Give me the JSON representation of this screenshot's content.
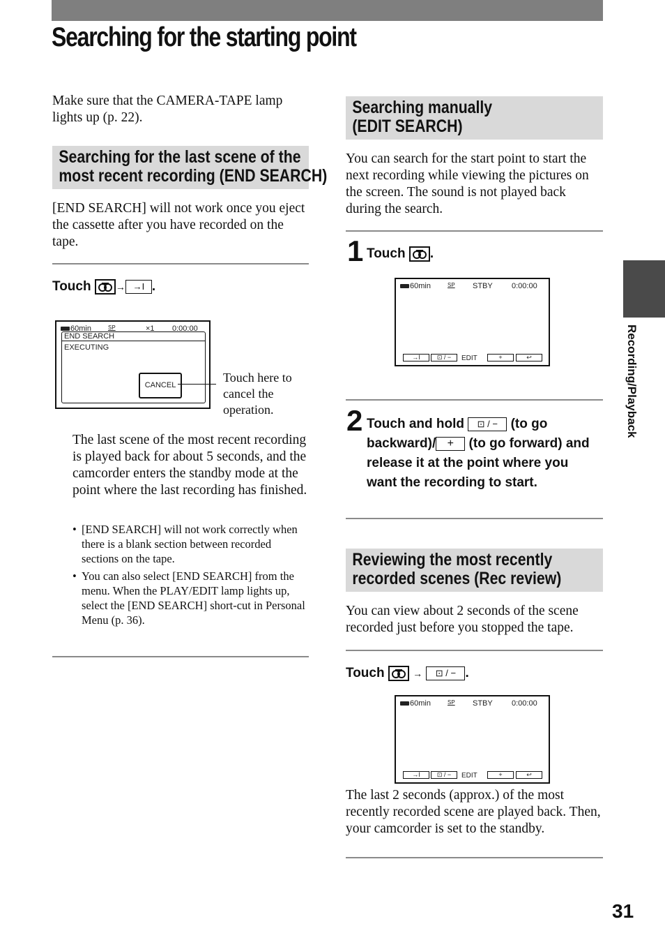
{
  "page": {
    "title": "Searching for the starting point",
    "page_number": "31",
    "side_tab_label": "Recording/Playback"
  },
  "left": {
    "intro": "Make sure that the CAMERA-TAPE lamp lights up (p. 22).",
    "section_heading_line1": "Searching for the last scene of the",
    "section_heading_line2": "most recent recording (END SEARCH)",
    "section_text": "[END SEARCH] will not work once you eject the cassette after you have recorded on the tape.",
    "touch_label": "Touch",
    "arrow": "→",
    "end_search_btn": "→I",
    "period": ".",
    "lcd": {
      "battery": "60min",
      "mode_icon": "SP",
      "speed": "×1",
      "counter": "0:00:00",
      "title": "END SEARCH",
      "status": "EXECUTING",
      "cancel": "CANCEL"
    },
    "callout": "Touch here to cancel the operation.",
    "result_text": "The last scene of the most recent recording is played back for about 5 seconds, and the camcorder enters the standby mode at the point where the last recording has finished.",
    "notes": [
      "[END SEARCH] will not work correctly when there is a blank section between recorded sections on the tape.",
      "You can also select [END SEARCH] from the menu. When the PLAY/EDIT lamp lights up, select the [END SEARCH] short-cut in Personal Menu (p. 36)."
    ]
  },
  "right": {
    "edit_heading_line1": "Searching manually",
    "edit_heading_line2": "(EDIT SEARCH)",
    "edit_text": "You can search for the start point to start the next recording while viewing the pictures on the screen. The sound is not played back during the search.",
    "step1_num": "1",
    "step1_text": "Touch",
    "step2_num": "2",
    "step2_a": "Touch and hold",
    "step2_back_btn": "⊡ / −",
    "step2_b": "(to go backward)/",
    "step2_fwd_btn": "+",
    "step2_c": "(to go forward) and release it at the point where you want the recording to start.",
    "lcd": {
      "battery": "60min",
      "mode_icon": "SP",
      "status": "STBY",
      "counter": "0:00:00",
      "btn_end": "→I",
      "btn_back": "⊡ / −",
      "edit": "EDIT",
      "btn_fwd": "+",
      "btn_return": "↩"
    },
    "review_heading_line1": "Reviewing the most recently",
    "review_heading_line2": "recorded scenes (Rec review)",
    "review_text": "You can view about 2 seconds of the scene recorded just before you stopped the tape.",
    "touch_label": "Touch",
    "review_btn": "⊡ / −",
    "review_result": "The last 2 seconds (approx.) of the most recently recorded scene are played back. Then, your camcorder is set to the standby."
  }
}
